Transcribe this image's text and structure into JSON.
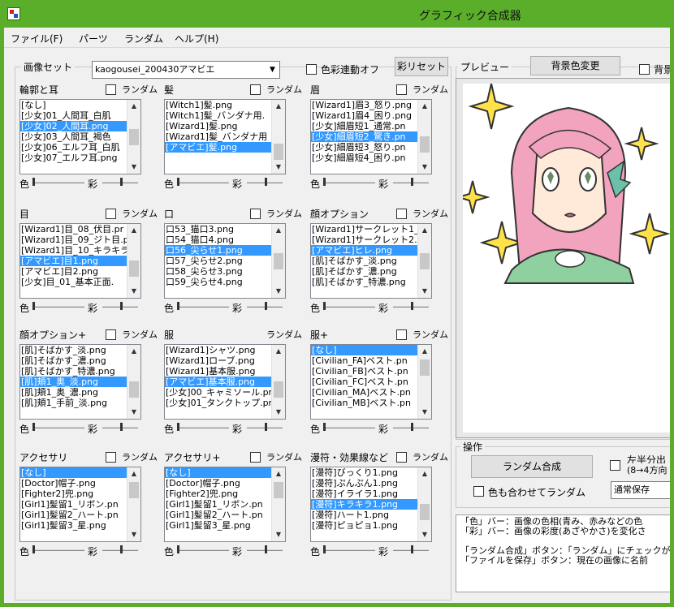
{
  "window": {
    "title": "グラフィック合成器"
  },
  "menu": [
    "ファイル(F)",
    "パーツ",
    "ランダム",
    "ヘルプ(H)"
  ],
  "image_set": {
    "label": "画像セット",
    "value": "kaogousei_200430アマビエ"
  },
  "color_link": {
    "label": "色彩連動オフ",
    "checked": false
  },
  "saturation_reset_button": "彩リセット",
  "preview": {
    "label": "プレビュー",
    "bg_button": "背景色変更",
    "bg_check_label": "背景"
  },
  "slider_labels": {
    "color": "色",
    "saturation": "彩"
  },
  "random_label": "ランダム",
  "panels": [
    {
      "title": "輪郭と耳",
      "has_check": true,
      "items": [
        "[なし]",
        "[少女]01_人間耳_白肌",
        "[少女]02_人間耳.png",
        "[少女]03_人間耳_褐色",
        "[少女]06_エルフ耳_白肌",
        "[少女]07_エルフ耳.png"
      ],
      "selected": 2
    },
    {
      "title": "髪",
      "has_check": true,
      "items": [
        "[Witch1]髪.png",
        "[Witch1]髪_バンダナ用.",
        "[Wizard1]髪.png",
        "[Wizard1]髪_バンダナ用",
        "[アマビエ]髪.png"
      ],
      "selected": 4
    },
    {
      "title": "眉",
      "has_check": true,
      "items": [
        "[Wizard1]眉3_怒り.png",
        "[Wizard1]眉4_困り.png",
        "[少女]細眉短1_通常.pn",
        "[少女]細眉短2_驚き.pn",
        "[少女]細眉短3_怒り.pn",
        "[少女]細眉短4_困り.pn"
      ],
      "selected": 3
    },
    {
      "title": "目",
      "has_check": true,
      "items": [
        "[Wizard1]目_08_伏目.pr",
        "[Wizard1]目_09_ジト目.p",
        "[Wizard1]目_10_キラキラ",
        "[アマビエ]目1.png",
        "[アマビエ]目2.png",
        "[少女]目_01_基本正面."
      ],
      "selected": 3
    },
    {
      "title": "口",
      "has_check": true,
      "items": [
        "口53_猫口3.png",
        "口54_猫口4.png",
        "口56_尖らせ1.png",
        "口57_尖らせ2.png",
        "口58_尖らせ3.png",
        "口59_尖らせ4.png"
      ],
      "selected": 2
    },
    {
      "title": "顔オプション",
      "has_check": true,
      "items": [
        "[Wizard1]サークレット1_",
        "[Wizard1]サークレット2.",
        "[アマビエ]ヒレ.png",
        "[肌]そばかす_淡.png",
        "[肌]そばかす_濃.png",
        "[肌]そばかす_特濃.png"
      ],
      "selected": 2
    },
    {
      "title": "顔オプション+",
      "has_check": true,
      "items": [
        "[肌]そばかす_淡.png",
        "[肌]そばかす_濃.png",
        "[肌]そばかす_特濃.png",
        "[肌]頬1_奥_淡.png",
        "[肌]頬1_奥_濃.png",
        "[肌]頬1_手前_淡.png"
      ],
      "selected": 3
    },
    {
      "title": "服",
      "has_check": false,
      "items": [
        "[Wizard1]シャツ.png",
        "[Wizard1]ローブ.png",
        "[Wizard1]基本服.png",
        "[アマビエ]基本服.png",
        "[少女]00_キャミソール.pr",
        "[少女]01_タンクトップ.pn"
      ],
      "selected": 3
    },
    {
      "title": "服+",
      "has_check": true,
      "items": [
        "[なし]",
        "[Civilian_FA]ベスト.pn",
        "[Civilian_FB]ベスト.pn",
        "[Civilian_FC]ベスト.pn",
        "[Civilian_MA]ベスト.pn",
        "[Civilian_MB]ベスト.pn"
      ],
      "selected": 0
    },
    {
      "title": "アクセサリ",
      "has_check": true,
      "items": [
        "[なし]",
        "[Doctor]帽子.png",
        "[Fighter2]兜.png",
        "[Girl1]髪留1_リボン.pn",
        "[Girl1]髪留2_ハート.pn",
        "[Girl1]髪留3_星.png"
      ],
      "selected": 0
    },
    {
      "title": "アクセサリ+",
      "has_check": true,
      "items": [
        "[なし]",
        "[Doctor]帽子.png",
        "[Fighter2]兜.png",
        "[Girl1]髪留1_リボン.pn",
        "[Girl1]髪留2_ハート.pn",
        "[Girl1]髪留3_星.png"
      ],
      "selected": 0
    },
    {
      "title": "漫符・効果線など",
      "has_check": true,
      "items": [
        "[漫符]びっくり1.png",
        "[漫符]ぷんぷん1.png",
        "[漫符]イライラ1.png",
        "[漫符]キラキラ1.png",
        "[漫符]ハート1.png",
        "[漫符]ピョピョ1.png"
      ],
      "selected": 3
    }
  ],
  "operation": {
    "label": "操作",
    "random_compose_button": "ランダム合成",
    "split_check_label": "左半分出",
    "split_check_sub": "(8→4方向",
    "color_random_label": "色も合わせてランダム",
    "save_mode_value": "通常保存"
  },
  "help_lines": [
    "「色」バー：画像の色相(青み、赤みなどの色",
    "「彩」バー：画像の彩度(あざやかさ)を変化さ",
    "",
    "「ランダム合成」ボタン：「ランダム」にチェックが",
    "「ファイルを保存」ボタン：現在の画像に名前"
  ]
}
